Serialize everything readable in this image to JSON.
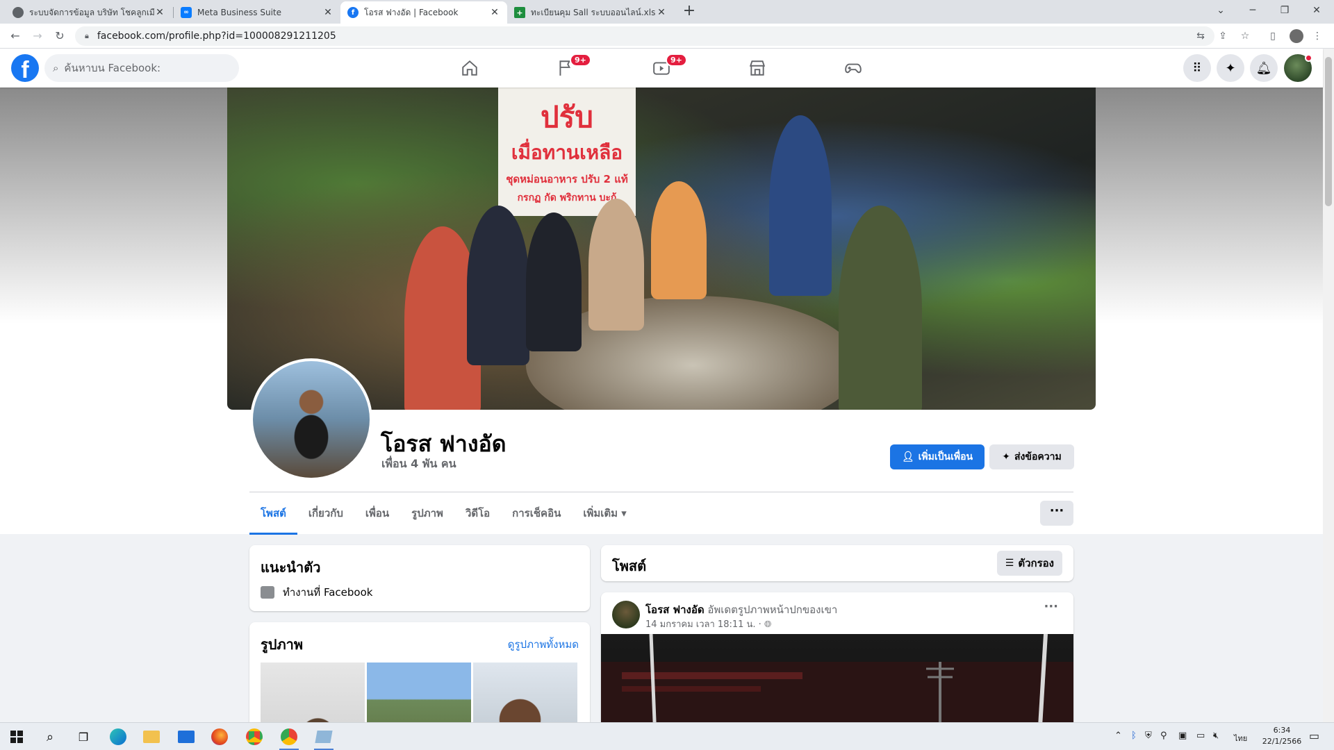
{
  "browser": {
    "tabs": [
      {
        "title": "ระบบจัดการข้อมูล บริษัท โชคลูกเมือต -",
        "icon_color": "#5f6368"
      },
      {
        "title": "Meta Business Suite",
        "icon_color": "#0a7cff"
      },
      {
        "title": "โอรส ฟางอัด | Facebook",
        "icon_color": "#1877f2",
        "active": true
      },
      {
        "title": "ทะเบียนคุม Sall ระบบออนไลน์.xlsx - G",
        "icon_color": "#1e8e3e"
      }
    ],
    "url": "facebook.com/profile.php?id=100008291211205"
  },
  "header": {
    "logo": "f",
    "search_placeholder": "ค้นหาบน Facebook:",
    "nav": [
      {
        "name": "home",
        "badge": ""
      },
      {
        "name": "pages",
        "badge": "9+"
      },
      {
        "name": "watch",
        "badge": "9+"
      },
      {
        "name": "marketplace",
        "badge": ""
      },
      {
        "name": "gaming",
        "badge": ""
      }
    ]
  },
  "cover": {
    "sign_line1": "ปรับ",
    "sign_line2": "เมื่อทานเหลือ",
    "sign_line3": "ชุดหม่อนอาหาร ปรับ 2 แท้",
    "sign_line4": "กรกฏ กัด พริกทาน บะก้"
  },
  "profile": {
    "name": "โอรส ฟางอัด",
    "friends": "เพื่อน 4 พัน คน",
    "add_friend": "เพิ่มเป็นเพื่อน",
    "message": "ส่งข้อความ",
    "tabs": [
      "โพสต์",
      "เกี่ยวกับ",
      "เพื่อน",
      "รูปภาพ",
      "วิดีโอ",
      "การเช็คอิน",
      "เพิ่มเติม ▾"
    ],
    "more": "···"
  },
  "intro": {
    "title": "แนะนำตัว",
    "work": "ทำงานที่ Facebook"
  },
  "photos": {
    "title": "รูปภาพ",
    "see_all": "ดูรูปภาพทั้งหมด"
  },
  "posts": {
    "title": "โพสต์",
    "filter": "ตัวกรอง",
    "item": {
      "author": "โอรส ฟางอัด",
      "action": "อัพเดตรูปภาพหน้าปกของเขา",
      "time": "14 มกราคม เวลา 18:11 น. · ",
      "more": "···"
    }
  },
  "taskbar": {
    "lang": "ไทย",
    "time": "6:34",
    "date": "22/1/2566"
  }
}
